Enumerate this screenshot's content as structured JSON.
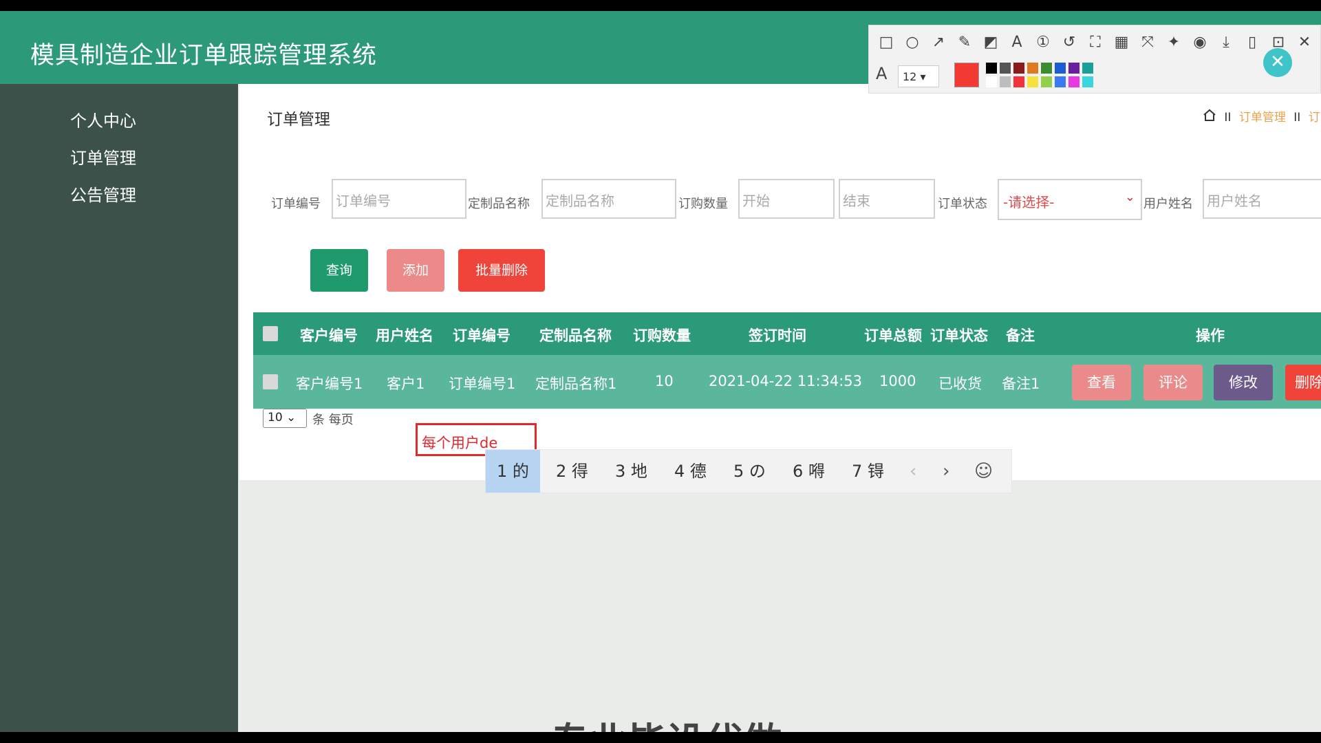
{
  "app": {
    "title": "模具制造企业订单跟踪管理系统",
    "colors": {
      "header": "#2c9a78",
      "sidebar": "#3d514b",
      "table_head": "#2a9a78",
      "table_row": "#5bb79b"
    }
  },
  "sidebar": {
    "items": [
      {
        "label": "个人中心"
      },
      {
        "label": "订单管理"
      },
      {
        "label": "公告管理"
      }
    ]
  },
  "page": {
    "title": "订单管理"
  },
  "breadcrumb": {
    "sep": "II",
    "items": [
      "订单管理",
      "订"
    ]
  },
  "filters": {
    "order_no": {
      "label": "订单编号",
      "placeholder": "订单编号"
    },
    "product": {
      "label": "定制品名称",
      "placeholder": "定制品名称"
    },
    "qty": {
      "label": "订购数量",
      "start": "开始",
      "end": "结束"
    },
    "status": {
      "label": "订单状态",
      "selected": "-请选择-"
    },
    "user": {
      "label": "用户姓名",
      "placeholder": "用户姓名"
    }
  },
  "actions": {
    "query": "查询",
    "add": "添加",
    "batch_delete": "批量删除"
  },
  "table": {
    "columns": [
      "客户编号",
      "用户姓名",
      "订单编号",
      "定制品名称",
      "订购数量",
      "签订时间",
      "订单总额",
      "订单状态",
      "备注",
      "操作"
    ],
    "rows": [
      {
        "customer_no": "客户编号1",
        "user_name": "客户1",
        "order_no": "订单编号1",
        "product": "定制品名称1",
        "qty": "10",
        "sign_time": "2021-04-22 11:34:53",
        "total": "1000",
        "status": "已收货",
        "remark": "备注1",
        "btn_view": "查看",
        "btn_comment": "评论",
        "btn_edit": "修改",
        "btn_delete": "删除"
      }
    ]
  },
  "pagination": {
    "page_size": "10",
    "per_page_label": "条 每页"
  },
  "ime": {
    "composition": "每个用户de",
    "candidates": [
      "1 的",
      "2 得",
      "3 地",
      "4 德",
      "5 の",
      "6 嘚",
      "7 锝"
    ],
    "prev": "‹",
    "next": "›",
    "emoji": "☺"
  },
  "watermark": "专业毕设代做",
  "screenshot_toolbar": {
    "font_size": "12",
    "current_color": "#f23a32",
    "palette": [
      "#000000",
      "#555555",
      "#8b1a1a",
      "#e07a22",
      "#3c8d2f",
      "#1e5bd6",
      "#6a1fa0",
      "#1aa09a",
      "#ffffff",
      "#bdbdbd",
      "#f2343a",
      "#f5e23a",
      "#90d04a",
      "#3a7af2",
      "#e83ae0",
      "#3ad6e0"
    ],
    "tools": [
      "rectangle-tool",
      "ellipse-tool",
      "arrow-tool",
      "pen-tool",
      "mosaic-tool",
      "text-tool",
      "number-tool",
      "undo-tool",
      "crop-tool",
      "ocr-tool",
      "fullscreen-tool",
      "pin-tool",
      "record-tool",
      "download-tool",
      "save-tool",
      "bookmark-tool",
      "close-tool"
    ]
  }
}
